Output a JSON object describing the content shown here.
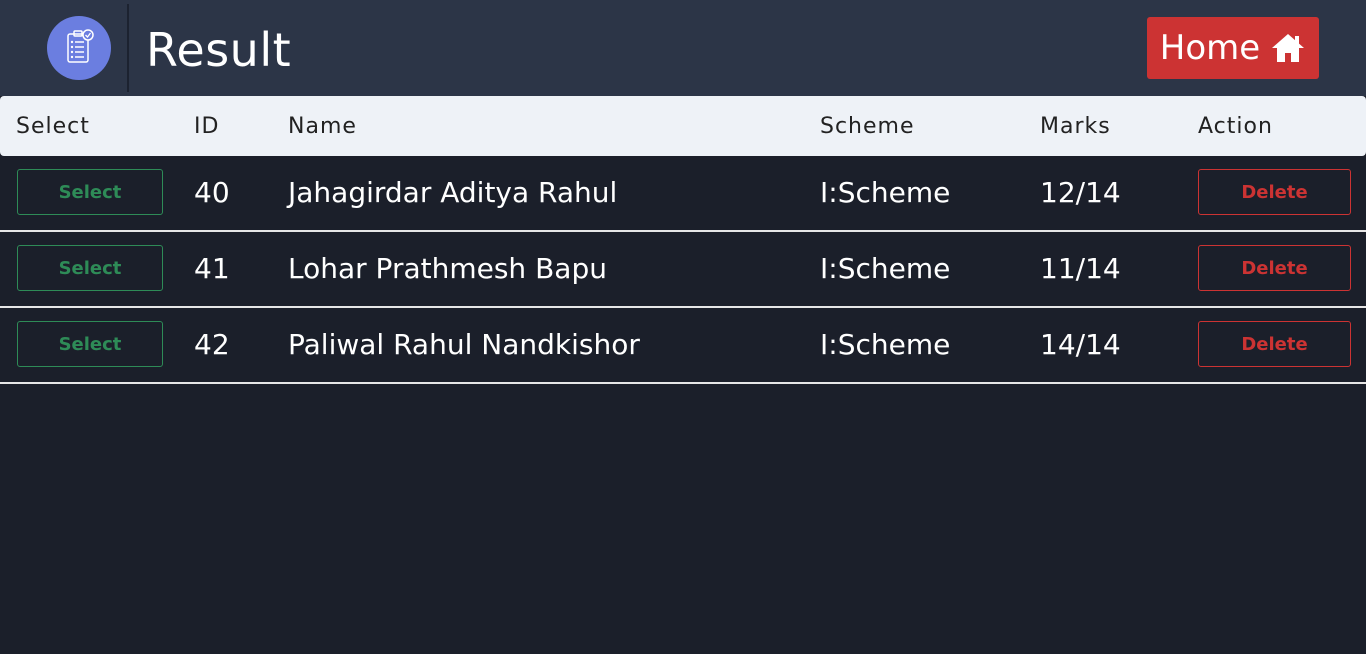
{
  "header": {
    "title": "Result",
    "logo_icon": "clipboard-checklist-icon",
    "home_label": "Home",
    "home_icon": "home-icon",
    "home_color": "#cc3333"
  },
  "table": {
    "columns": [
      "Select",
      "ID",
      "Name",
      "Scheme",
      "Marks",
      "Action"
    ],
    "rows": [
      {
        "select_label": "Select",
        "id": "40",
        "name": "Jahagirdar Aditya Rahul",
        "scheme": "I:Scheme",
        "marks": "12/14",
        "action_label": "Delete"
      },
      {
        "select_label": "Select",
        "id": "41",
        "name": "Lohar Prathmesh Bapu",
        "scheme": "I:Scheme",
        "marks": "11/14",
        "action_label": "Delete"
      },
      {
        "select_label": "Select",
        "id": "42",
        "name": "Paliwal Rahul Nandkishor",
        "scheme": "I:Scheme",
        "marks": "14/14",
        "action_label": "Delete"
      }
    ]
  },
  "colors": {
    "select_accent": "#2e8b57",
    "delete_accent": "#cc3333",
    "background": "#1b1f2a",
    "header_background": "#2c3547",
    "logo_background": "#6b7ee0"
  }
}
